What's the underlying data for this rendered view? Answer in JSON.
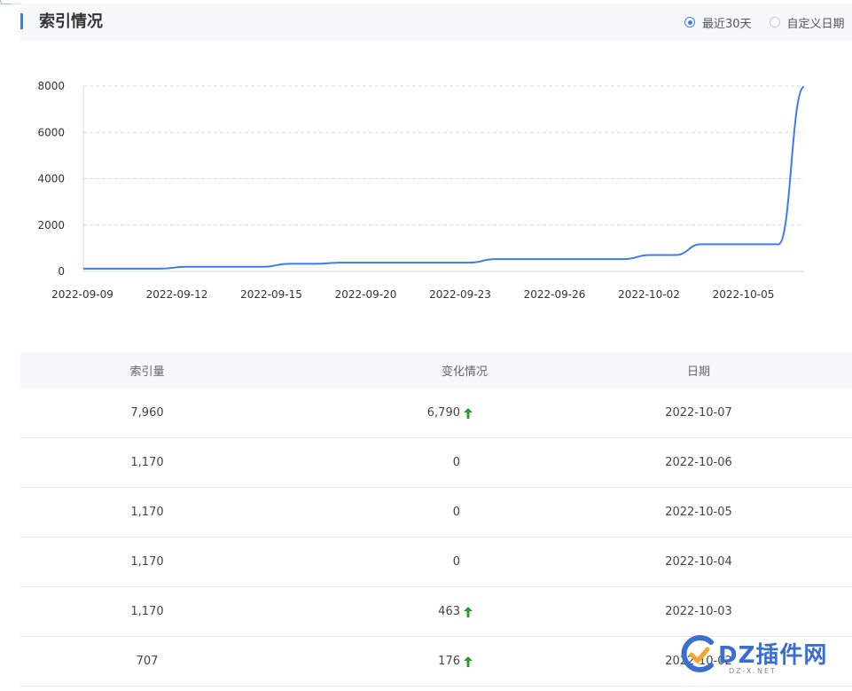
{
  "header": {
    "title": "索引情况",
    "radio_options": [
      {
        "label": "最近30天",
        "checked": true
      },
      {
        "label": "自定义日期",
        "checked": false
      }
    ],
    "accent_color": "#3b7ded"
  },
  "chart_data": {
    "type": "line",
    "x": [
      "2022-09-09",
      "2022-09-10",
      "2022-09-11",
      "2022-09-12",
      "2022-09-13",
      "2022-09-14",
      "2022-09-15",
      "2022-09-16",
      "2022-09-17",
      "2022-09-18",
      "2022-09-19",
      "2022-09-20",
      "2022-09-21",
      "2022-09-22",
      "2022-09-23",
      "2022-09-24",
      "2022-09-25",
      "2022-09-26",
      "2022-09-27",
      "2022-09-28",
      "2022-09-29",
      "2022-09-30",
      "2022-10-01",
      "2022-10-02",
      "2022-10-03",
      "2022-10-04",
      "2022-10-05",
      "2022-10-06",
      "2022-10-07"
    ],
    "x_tick_labels": [
      "2022-09-09",
      "2022-09-12",
      "2022-09-15",
      "2022-09-20",
      "2022-09-23",
      "2022-09-26",
      "2022-10-02",
      "2022-10-05"
    ],
    "series": [
      {
        "values": [
          120,
          120,
          120,
          120,
          200,
          200,
          200,
          200,
          330,
          330,
          380,
          380,
          380,
          380,
          380,
          380,
          530,
          530,
          530,
          530,
          530,
          531,
          707,
          707,
          1170,
          1170,
          1170,
          1170,
          7960
        ],
        "color": "#3b7ded"
      }
    ],
    "ylim": [
      0,
      8000
    ],
    "y_ticks": [
      0,
      2000,
      4000,
      6000,
      8000
    ],
    "grid": true,
    "title": "",
    "xlabel": "",
    "ylabel": ""
  },
  "table": {
    "headers": [
      "索引量",
      "变化情况",
      "日期"
    ],
    "rows": [
      {
        "count": "7,960",
        "change": "6,790",
        "up": true,
        "date": "2022-10-07"
      },
      {
        "count": "1,170",
        "change": "0",
        "up": false,
        "date": "2022-10-06"
      },
      {
        "count": "1,170",
        "change": "0",
        "up": false,
        "date": "2022-10-05"
      },
      {
        "count": "1,170",
        "change": "0",
        "up": false,
        "date": "2022-10-04"
      },
      {
        "count": "1,170",
        "change": "463",
        "up": true,
        "date": "2022-10-03"
      },
      {
        "count": "707",
        "change": "176",
        "up": true,
        "date": "2022-10-02"
      }
    ],
    "up_color": "#2e9a2e"
  },
  "watermark": {
    "text": "DZ插件网",
    "sub": "DZ-X.NET"
  }
}
